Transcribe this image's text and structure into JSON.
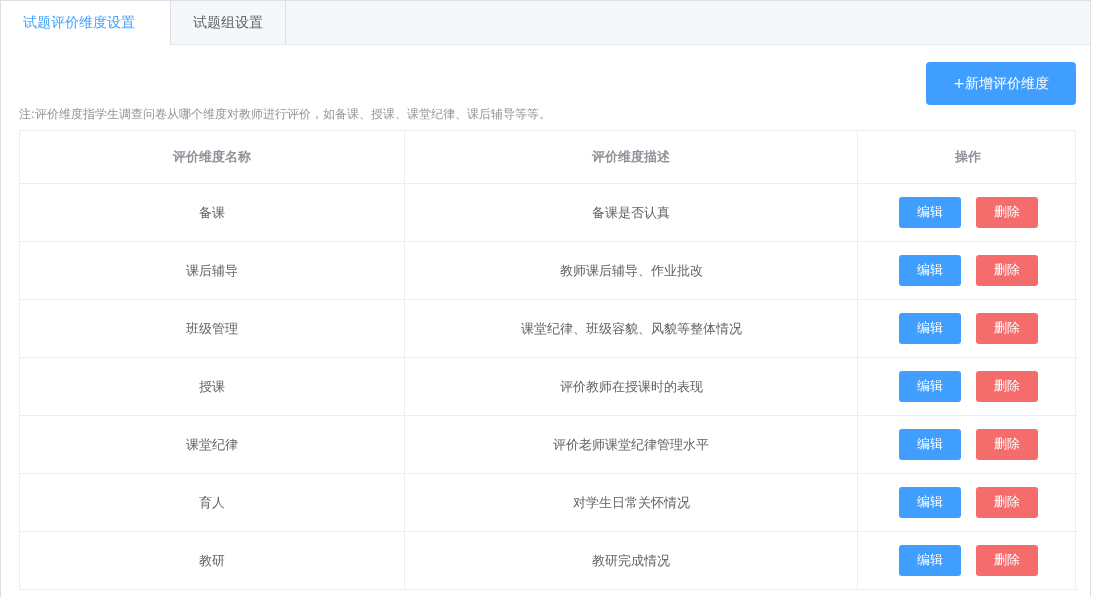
{
  "tabs": [
    {
      "label": "试题评价维度设置",
      "selected": true
    },
    {
      "label": "试题组设置",
      "selected": false
    }
  ],
  "add_button": "+新增评价维度",
  "note": "注:评价维度指学生调查问卷从哪个维度对教师进行评价，如备课、授课、课堂纪律、课后辅导等等。",
  "table": {
    "columns": [
      "评价维度名称",
      "评价维度描述",
      "操作"
    ],
    "rows": [
      {
        "name": "备课",
        "description": "备课是否认真",
        "actions": [
          {
            "kind": "edit",
            "label": "编辑"
          },
          {
            "kind": "delete",
            "label": "删除"
          }
        ]
      },
      {
        "name": "课后辅导",
        "description": "教师课后辅导、作业批改",
        "actions": [
          {
            "kind": "edit",
            "label": "编辑"
          },
          {
            "kind": "delete",
            "label": "删除"
          }
        ]
      },
      {
        "name": "班级管理",
        "description": "课堂纪律、班级容貌、风貌等整体情况",
        "actions": [
          {
            "kind": "edit",
            "label": "编辑"
          },
          {
            "kind": "delete",
            "label": "删除"
          }
        ]
      },
      {
        "name": "授课",
        "description": "评价教师在授课时的表现",
        "actions": [
          {
            "kind": "edit",
            "label": "编辑"
          },
          {
            "kind": "delete",
            "label": "删除"
          }
        ]
      },
      {
        "name": "课堂纪律",
        "description": "评价老师课堂纪律管理水平",
        "actions": [
          {
            "kind": "edit",
            "label": "编辑"
          },
          {
            "kind": "delete",
            "label": "删除"
          }
        ]
      },
      {
        "name": "育人",
        "description": "对学生日常关怀情况",
        "actions": [
          {
            "kind": "edit",
            "label": "编辑"
          },
          {
            "kind": "delete",
            "label": "删除"
          }
        ]
      },
      {
        "name": "教研",
        "description": "教研完成情况",
        "actions": [
          {
            "kind": "edit",
            "label": "编辑"
          },
          {
            "kind": "delete",
            "label": "删除"
          }
        ]
      }
    ]
  }
}
